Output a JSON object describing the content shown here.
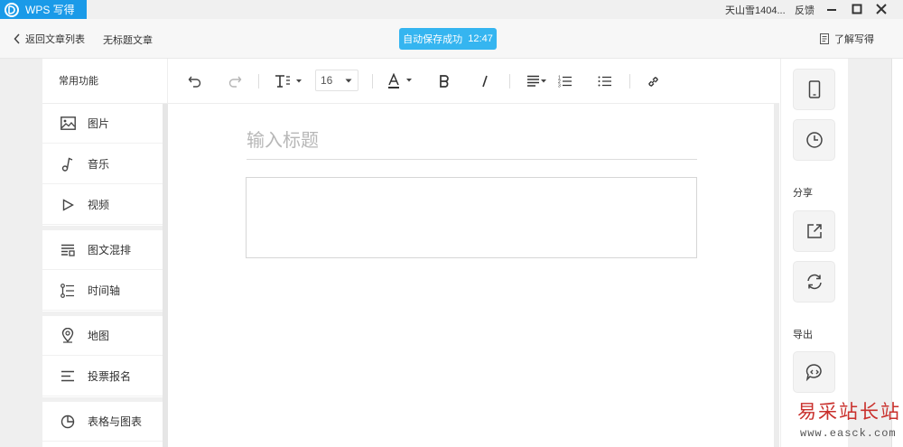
{
  "window": {
    "app_title": "WPS 写得",
    "user_name": "天山雪1404...",
    "feedback_label": "反馈"
  },
  "header": {
    "back_label": "返回文章列表",
    "doc_title": "无标题文章",
    "save_status": "自动保存成功",
    "save_time": "12:47",
    "learn_label": "了解写得"
  },
  "sidebar": {
    "header": "常用功能",
    "items": [
      {
        "label": "图片",
        "icon": "image-icon"
      },
      {
        "label": "音乐",
        "icon": "music-note-icon"
      },
      {
        "label": "视频",
        "icon": "play-icon"
      },
      {
        "label": "图文混排",
        "icon": "text-image-layout-icon"
      },
      {
        "label": "时间轴",
        "icon": "timeline-icon"
      },
      {
        "label": "地图",
        "icon": "map-pin-icon"
      },
      {
        "label": "投票报名",
        "icon": "vote-list-icon"
      },
      {
        "label": "表格与图表",
        "icon": "pie-chart-icon"
      }
    ]
  },
  "toolbar": {
    "font_size": "16",
    "tools": [
      "undo",
      "redo",
      "text-style",
      "font-size",
      "font-color",
      "bold",
      "italic",
      "align",
      "ordered-list",
      "unordered-list",
      "link"
    ]
  },
  "editor": {
    "title_placeholder": "输入标题"
  },
  "right_panel": {
    "share_label": "分享",
    "export_label": "导出",
    "buttons": [
      "mobile-preview-icon",
      "history-clock-icon",
      "share-external-icon",
      "sync-refresh-icon",
      "export-chat-icon"
    ]
  },
  "watermark": {
    "site_name": "易采站长站",
    "site_url": "www.easck.com"
  },
  "colors": {
    "accent": "#1a9ae8",
    "save_badge": "#35b5f0",
    "watermark_red": "#c9302c"
  }
}
